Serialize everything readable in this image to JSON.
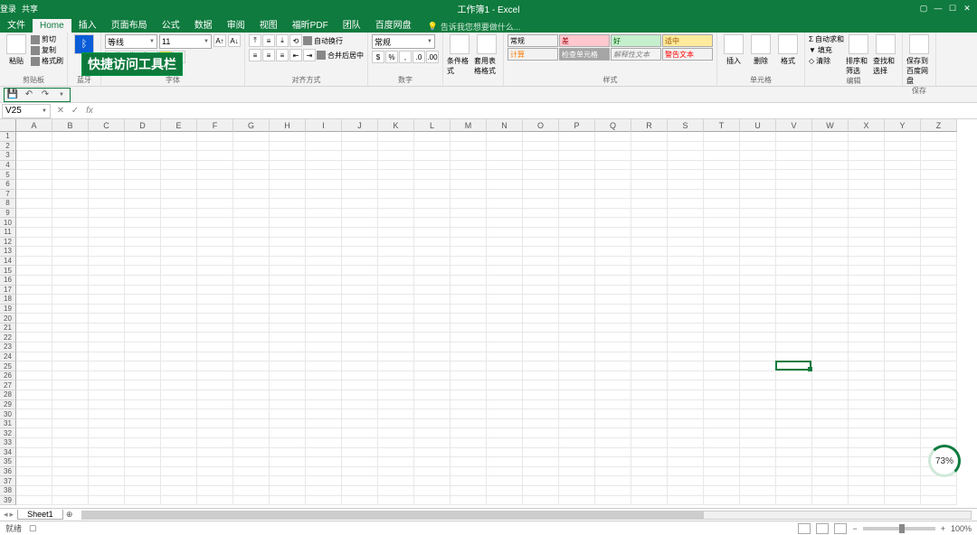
{
  "titlebar": {
    "title": "工作簿1 - Excel",
    "login": "登录",
    "share": "共享"
  },
  "tabs": [
    "文件",
    "Home",
    "插入",
    "页面布局",
    "公式",
    "数据",
    "审阅",
    "视图",
    "福昕PDF",
    "团队",
    "百度网盘"
  ],
  "active_tab": 1,
  "tell_me": "告诉我您想要做什么...",
  "annotation": "快捷访问工具栏",
  "ribbon": {
    "clipboard": {
      "paste": "粘贴",
      "cut": "剪切",
      "copy": "复制",
      "brush": "格式刷",
      "label": "剪贴板"
    },
    "bt": {
      "label": "蓝牙"
    },
    "font": {
      "name": "等线",
      "size": "11",
      "label": "字体"
    },
    "align": {
      "wrap": "自动换行",
      "merge": "合并后居中",
      "label": "对齐方式"
    },
    "number": {
      "format": "常规",
      "label": "数字"
    },
    "cond": {
      "cond": "条件格式",
      "table": "套用表格格式",
      "label": ""
    },
    "styles": {
      "items": [
        "常规",
        "差",
        "好",
        "适中",
        "计算",
        "检查单元格",
        "解释性文本",
        "警告文本"
      ],
      "label": "样式"
    },
    "cells": {
      "insert": "插入",
      "delete": "删除",
      "format": "格式",
      "label": "单元格"
    },
    "editing": {
      "sum": "自动求和",
      "fill": "填充",
      "clear": "清除",
      "sort": "排序和筛选",
      "find": "查找和选择",
      "label": "编辑"
    },
    "save": {
      "btn": "保存到百度网盘",
      "label": "保存"
    }
  },
  "name_box": "V25",
  "columns": [
    "A",
    "B",
    "C",
    "D",
    "E",
    "F",
    "G",
    "H",
    "I",
    "J",
    "K",
    "L",
    "M",
    "N",
    "O",
    "P",
    "Q",
    "R",
    "S",
    "T",
    "U",
    "V",
    "W",
    "X",
    "Y",
    "Z"
  ],
  "row_count": 39,
  "active": {
    "col_index": 21,
    "row_index": 24
  },
  "sheet": {
    "name": "Sheet1"
  },
  "status": {
    "ready": "就绪",
    "zoom": "100%"
  },
  "ring": "73%"
}
